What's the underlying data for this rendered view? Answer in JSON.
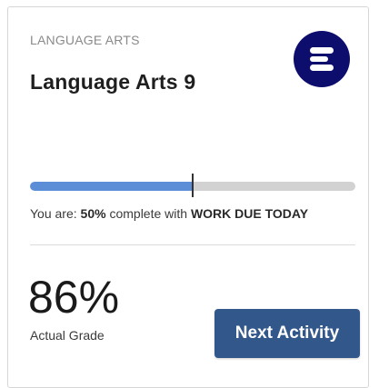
{
  "card": {
    "subject": "LANGUAGE ARTS",
    "course_title": "Language Arts 9",
    "logo_icon": "edgenuity-e-logo-icon"
  },
  "progress": {
    "percent": 50,
    "status_prefix": "You are:",
    "percent_text": "50%",
    "status_middle": "complete with",
    "status_due": "WORK DUE TODAY"
  },
  "grade": {
    "value": "86%",
    "label": "Actual Grade"
  },
  "actions": {
    "next_label": "Next Activity"
  },
  "colors": {
    "progress_fill": "#5b8ed6",
    "progress_track": "#d2d2d2",
    "logo_bg": "#0d0d6e",
    "button_bg": "#32578a"
  }
}
